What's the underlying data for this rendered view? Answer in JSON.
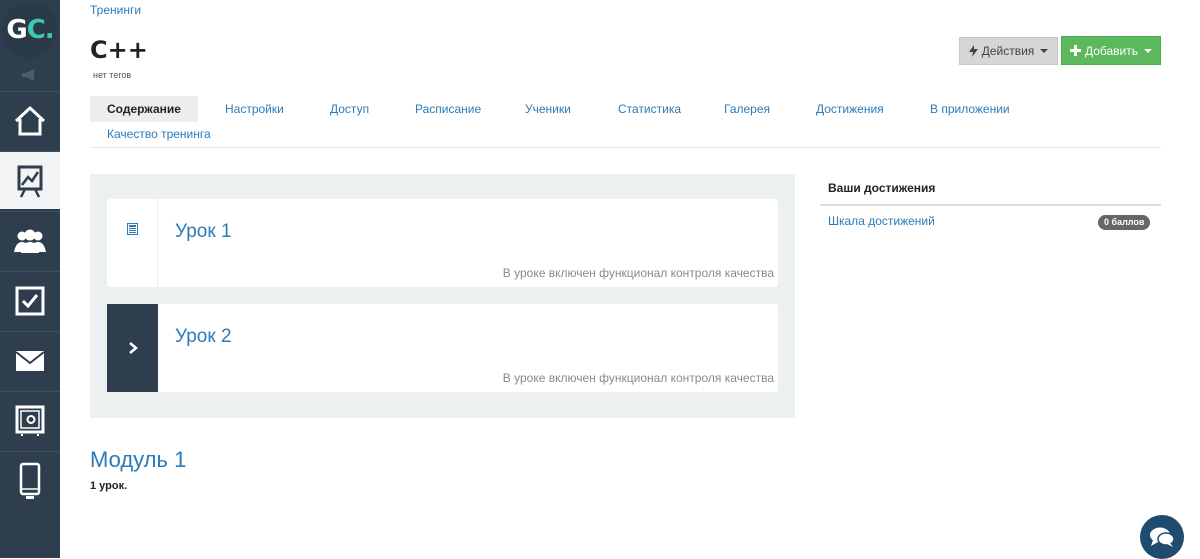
{
  "logo": {
    "letter_g": "G",
    "letter_c": "C."
  },
  "breadcrumb": "Тренинги",
  "header": {
    "title": "C++",
    "subtitle": "нет тегов",
    "actions_label": "Действия",
    "add_label": "Добавить"
  },
  "sidebar": {
    "items": [
      {
        "icon": "home-icon"
      },
      {
        "icon": "chart-board-icon",
        "active": true
      },
      {
        "icon": "users-icon"
      },
      {
        "icon": "checkbox-icon"
      },
      {
        "icon": "mail-icon"
      },
      {
        "icon": "safe-icon"
      },
      {
        "icon": "mobile-icon"
      }
    ]
  },
  "tabs": [
    {
      "label": "Содержание",
      "active": true
    },
    {
      "label": "Настройки"
    },
    {
      "label": "Доступ"
    },
    {
      "label": "Расписание"
    },
    {
      "label": "Ученики"
    },
    {
      "label": "Статистика"
    },
    {
      "label": "Галерея"
    },
    {
      "label": "Достижения"
    },
    {
      "label": "В приложении"
    },
    {
      "label": "Качество тренинга"
    }
  ],
  "lessons": [
    {
      "title": "Урок 1",
      "note": "В уроке включен функционал контроля качества",
      "icon": "document-icon"
    },
    {
      "title": "Урок 2",
      "note": "В уроке включен функционал контроля качества",
      "icon": "chevron-right-icon"
    }
  ],
  "module": {
    "title": "Модуль 1",
    "count": "1 урок."
  },
  "achievements": {
    "title": "Ваши достижения",
    "link": "Шкала достижений",
    "badge": "0 баллов"
  },
  "colors": {
    "sidebar_bg": "#2e3e4e",
    "link": "#2b7bb9",
    "accent_green": "#5cb85c",
    "logo_accent": "#3ec7b6"
  }
}
